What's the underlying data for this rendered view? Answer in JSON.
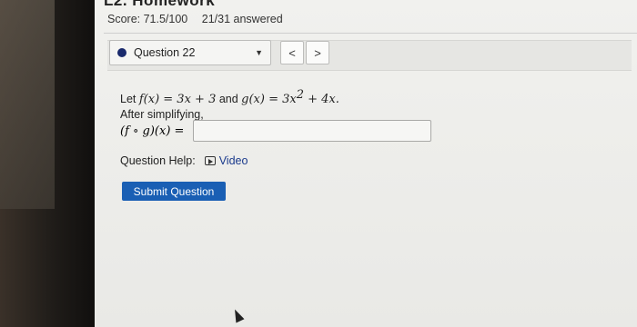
{
  "header": {
    "partial_title": "L2. Homework",
    "score_text": "Score: 71.5/100",
    "answered_text": "21/31 answered"
  },
  "question_nav": {
    "selected_label": "Question 22",
    "prev_glyph": "<",
    "next_glyph": ">"
  },
  "problem": {
    "let_prefix": "Let ",
    "f_def": "f(x) = 3x + 3",
    "and_text": " and ",
    "g_def_lhs": "g(x) = 3x",
    "g_exp": "2",
    "g_def_rhs": " + 4x.",
    "instruction": "After simplifying,",
    "composition_label": "(f ∘ g)(x) =",
    "answer_value": "",
    "answer_placeholder": ""
  },
  "help": {
    "label": "Question Help:",
    "video_icon": "video-play-icon",
    "video_link": "Video"
  },
  "actions": {
    "submit_label": "Submit Question"
  },
  "colors": {
    "submit_bg": "#1a5fb4",
    "link": "#1a3a8c",
    "status_dot": "#1a2a6c"
  }
}
